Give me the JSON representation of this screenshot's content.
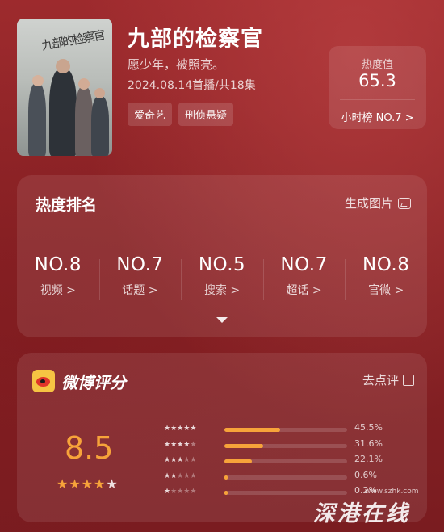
{
  "show": {
    "poster_calligraphy": "九部的检察官",
    "title": "九部的检察官",
    "tagline": "愿少年，被照亮。",
    "air_info": "2024.08.14首播/共18集",
    "tags": [
      "爱奇艺",
      "刑侦悬疑"
    ]
  },
  "heat": {
    "label": "热度值",
    "value": "65.3",
    "rank_text": "小时榜 NO.7 >"
  },
  "ranking": {
    "title": "热度排名",
    "generate_image_label": "生成图片",
    "items": [
      {
        "rank": "NO.8",
        "name": "视频 >"
      },
      {
        "rank": "NO.7",
        "name": "话题 >"
      },
      {
        "rank": "NO.5",
        "name": "搜索 >"
      },
      {
        "rank": "NO.7",
        "name": "超话 >"
      },
      {
        "rank": "NO.8",
        "name": "官微 >"
      }
    ]
  },
  "weibo_rating": {
    "title": "微博评分",
    "rate_action_label": "去点评",
    "score": "8.5",
    "score_stars": 4.5,
    "distribution": [
      {
        "stars": 5,
        "percent": 45.5,
        "label": "45.5%"
      },
      {
        "stars": 4,
        "percent": 31.6,
        "label": "31.6%"
      },
      {
        "stars": 3,
        "percent": 22.1,
        "label": "22.1%"
      },
      {
        "stars": 2,
        "percent": 0.6,
        "label": "0.6%"
      },
      {
        "stars": 1,
        "percent": 0.2,
        "label": "0.2%"
      }
    ]
  },
  "watermark": {
    "url": "www.szhk.com",
    "text": "深港在线"
  },
  "colors": {
    "background": "#8b2326",
    "accent_orange": "#f7a33a",
    "weibo_yellow": "#f6c343",
    "weibo_red": "#e0332a"
  }
}
